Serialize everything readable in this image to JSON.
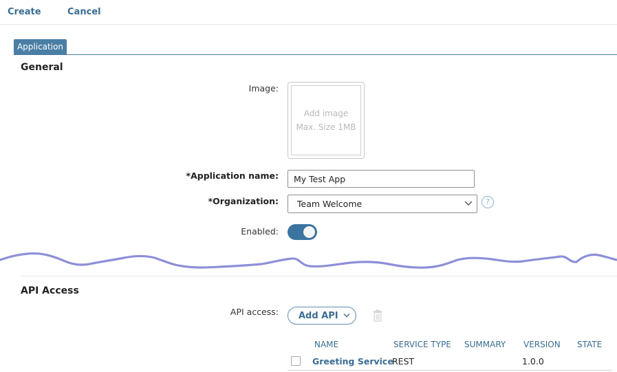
{
  "toolbar": {
    "create_label": "Create",
    "cancel_label": "Cancel"
  },
  "tabs": [
    {
      "label": "Application",
      "active": true
    }
  ],
  "general": {
    "title": "General",
    "image": {
      "label": "Image:",
      "placeholder_line1": "Add image",
      "placeholder_line2": "Max. Size 1MB"
    },
    "app_name": {
      "label": "*Application name:",
      "value": "My Test App"
    },
    "organization": {
      "label": "*Organization:",
      "selected": "Team Welcome"
    },
    "enabled": {
      "label": "Enabled:",
      "on": true
    }
  },
  "api_access": {
    "title": "API Access",
    "label": "API access:",
    "add_button": "Add API",
    "columns": [
      "NAME",
      "SERVICE TYPE",
      "SUMMARY",
      "VERSION",
      "STATE"
    ],
    "rows": [
      {
        "name": "Greeting Service",
        "service_type": "REST",
        "summary": "",
        "version": "1.0.0",
        "state": ""
      }
    ]
  },
  "colors": {
    "accent": "#3a6d94",
    "tab": "#4a7ea5",
    "toggle": "#3b74a0",
    "squiggle": "#8d8fd8"
  },
  "icons": [
    "chevron-down-icon",
    "help-icon",
    "trash-icon"
  ]
}
